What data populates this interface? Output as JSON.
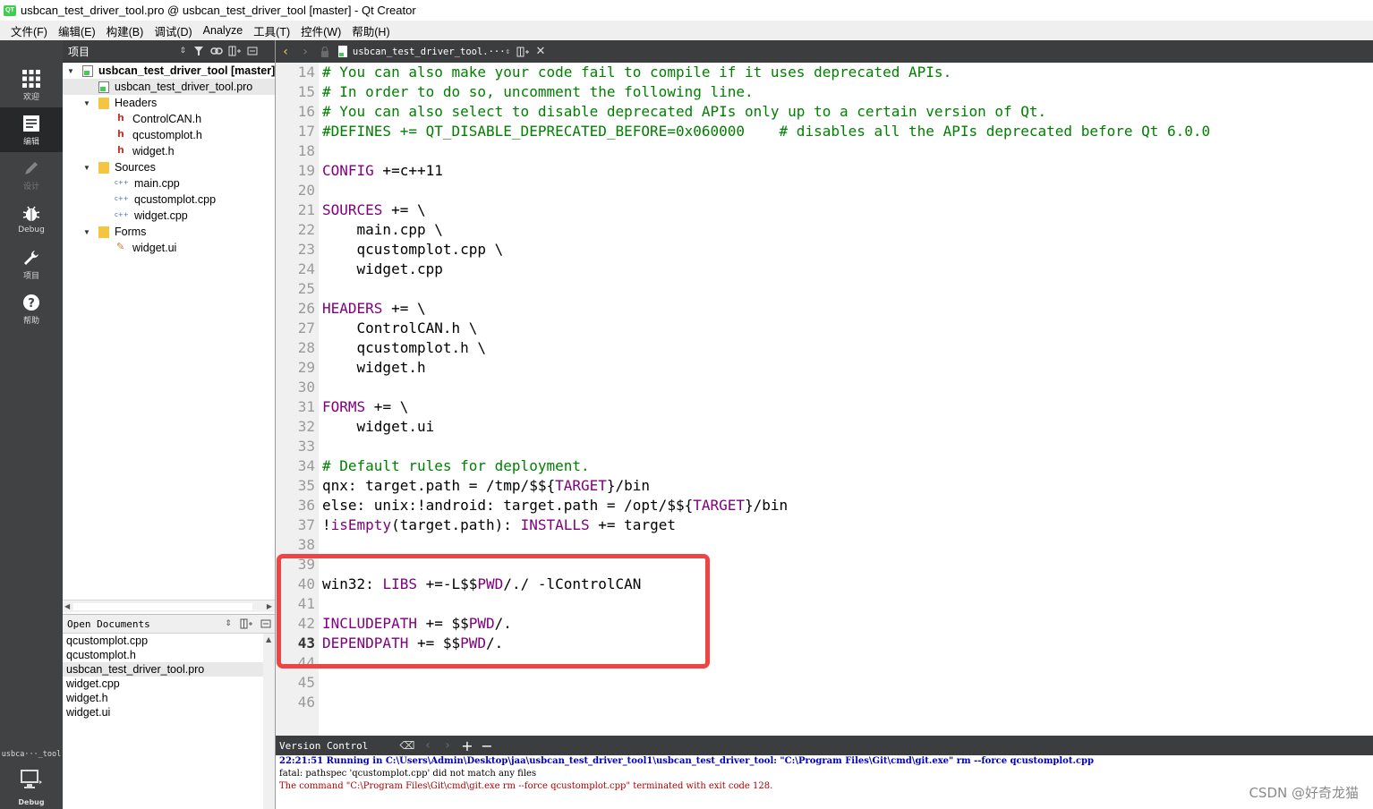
{
  "window": {
    "title": "usbcan_test_driver_tool.pro @ usbcan_test_driver_tool [master] - Qt Creator"
  },
  "menubar": [
    "文件(F)",
    "编辑(E)",
    "构建(B)",
    "调试(D)",
    "Analyze",
    "工具(T)",
    "控件(W)",
    "帮助(H)"
  ],
  "modes": [
    {
      "label": "欢迎",
      "icon": "grid-icon",
      "active": false
    },
    {
      "label": "编辑",
      "icon": "edit-document-icon",
      "active": true
    },
    {
      "label": "设计",
      "icon": "pencil-icon",
      "active": false
    },
    {
      "label": "Debug",
      "icon": "bug-icon",
      "active": false
    },
    {
      "label": "项目",
      "icon": "wrench-icon",
      "active": false
    },
    {
      "label": "帮助",
      "icon": "help-icon",
      "active": false
    }
  ],
  "kit": {
    "label": "usbca···_tool",
    "mode": "Debug",
    "icon": "monitor-icon"
  },
  "project_panel": {
    "combo_label": "项目",
    "tree": [
      {
        "label": "usbcan_test_driver_tool [master]",
        "type": "project",
        "level": 0,
        "expanded": true,
        "bold": true
      },
      {
        "label": "usbcan_test_driver_tool.pro",
        "type": "pro",
        "level": 1,
        "selected": true
      },
      {
        "label": "Headers",
        "type": "folder",
        "level": 1,
        "expanded": true
      },
      {
        "label": "ControlCAN.h",
        "type": "h",
        "level": 2
      },
      {
        "label": "qcustomplot.h",
        "type": "h",
        "level": 2
      },
      {
        "label": "widget.h",
        "type": "h",
        "level": 2
      },
      {
        "label": "Sources",
        "type": "folder",
        "level": 1,
        "expanded": true
      },
      {
        "label": "main.cpp",
        "type": "cpp",
        "level": 2
      },
      {
        "label": "qcustomplot.cpp",
        "type": "cpp",
        "level": 2
      },
      {
        "label": "widget.cpp",
        "type": "cpp",
        "level": 2
      },
      {
        "label": "Forms",
        "type": "forms",
        "level": 1,
        "expanded": true
      },
      {
        "label": "widget.ui",
        "type": "ui",
        "level": 2
      }
    ]
  },
  "open_documents": {
    "title": "Open Documents",
    "items": [
      {
        "label": "qcustomplot.cpp",
        "selected": false
      },
      {
        "label": "qcustomplot.h",
        "selected": false
      },
      {
        "label": "usbcan_test_driver_tool.pro",
        "selected": true
      },
      {
        "label": "widget.cpp",
        "selected": false
      },
      {
        "label": "widget.h",
        "selected": false
      },
      {
        "label": "widget.ui",
        "selected": false
      }
    ]
  },
  "editor": {
    "current_document": "usbcan_test_driver_tool.···",
    "current_line": 43,
    "lines": [
      {
        "n": 14,
        "parts": [
          {
            "t": "# You can also make your code fail to compile if it uses deprecated APIs.",
            "c": "cm"
          }
        ]
      },
      {
        "n": 15,
        "parts": [
          {
            "t": "# In order to do so, uncomment the following line.",
            "c": "cm"
          }
        ]
      },
      {
        "n": 16,
        "parts": [
          {
            "t": "# You can also select to disable deprecated APIs only up to a certain version of Qt.",
            "c": "cm"
          }
        ]
      },
      {
        "n": 17,
        "parts": [
          {
            "t": "#DEFINES += QT_DISABLE_DEPRECATED_BEFORE=0x060000    # disables all the APIs deprecated before Qt 6.0.0",
            "c": "cm"
          }
        ]
      },
      {
        "n": 18,
        "parts": []
      },
      {
        "n": 19,
        "parts": [
          {
            "t": "CONFIG",
            "c": "kw"
          },
          {
            "t": " +=c++11",
            "c": ""
          }
        ]
      },
      {
        "n": 20,
        "parts": []
      },
      {
        "n": 21,
        "parts": [
          {
            "t": "SOURCES",
            "c": "kw"
          },
          {
            "t": " += \\",
            "c": ""
          }
        ]
      },
      {
        "n": 22,
        "parts": [
          {
            "t": "    main.cpp \\",
            "c": ""
          }
        ]
      },
      {
        "n": 23,
        "parts": [
          {
            "t": "    qcustomplot.cpp \\",
            "c": ""
          }
        ]
      },
      {
        "n": 24,
        "parts": [
          {
            "t": "    widget.cpp",
            "c": ""
          }
        ]
      },
      {
        "n": 25,
        "parts": []
      },
      {
        "n": 26,
        "parts": [
          {
            "t": "HEADERS",
            "c": "kw"
          },
          {
            "t": " += \\",
            "c": ""
          }
        ]
      },
      {
        "n": 27,
        "parts": [
          {
            "t": "    ControlCAN.h \\",
            "c": ""
          }
        ]
      },
      {
        "n": 28,
        "parts": [
          {
            "t": "    qcustomplot.h \\",
            "c": ""
          }
        ]
      },
      {
        "n": 29,
        "parts": [
          {
            "t": "    widget.h",
            "c": ""
          }
        ]
      },
      {
        "n": 30,
        "parts": []
      },
      {
        "n": 31,
        "parts": [
          {
            "t": "FORMS",
            "c": "kw"
          },
          {
            "t": " += \\",
            "c": ""
          }
        ]
      },
      {
        "n": 32,
        "parts": [
          {
            "t": "    widget.ui",
            "c": ""
          }
        ]
      },
      {
        "n": 33,
        "parts": []
      },
      {
        "n": 34,
        "parts": [
          {
            "t": "# Default rules for deployment.",
            "c": "cm"
          }
        ]
      },
      {
        "n": 35,
        "parts": [
          {
            "t": "qnx: target.path = /tmp/$${",
            "c": ""
          },
          {
            "t": "TARGET",
            "c": "kw"
          },
          {
            "t": "}/bin",
            "c": ""
          }
        ]
      },
      {
        "n": 36,
        "parts": [
          {
            "t": "else: unix:!android: target.path = /opt/$${",
            "c": ""
          },
          {
            "t": "TARGET",
            "c": "kw"
          },
          {
            "t": "}/bin",
            "c": ""
          }
        ]
      },
      {
        "n": 37,
        "parts": [
          {
            "t": "!",
            "c": ""
          },
          {
            "t": "isEmpty",
            "c": "kw"
          },
          {
            "t": "(target.path): ",
            "c": ""
          },
          {
            "t": "INSTALLS",
            "c": "kw"
          },
          {
            "t": " += target",
            "c": ""
          }
        ]
      },
      {
        "n": 38,
        "parts": []
      },
      {
        "n": 39,
        "parts": []
      },
      {
        "n": 40,
        "parts": [
          {
            "t": "win32: ",
            "c": ""
          },
          {
            "t": "LIBS",
            "c": "kw"
          },
          {
            "t": " +=-L$$",
            "c": ""
          },
          {
            "t": "PWD",
            "c": "kw"
          },
          {
            "t": "/./ -lControlCAN",
            "c": ""
          }
        ]
      },
      {
        "n": 41,
        "parts": []
      },
      {
        "n": 42,
        "parts": [
          {
            "t": "INCLUDEPATH",
            "c": "kw"
          },
          {
            "t": " += $$",
            "c": ""
          },
          {
            "t": "PWD",
            "c": "kw"
          },
          {
            "t": "/.",
            "c": ""
          }
        ]
      },
      {
        "n": 43,
        "parts": [
          {
            "t": "DEPENDPATH",
            "c": "kw"
          },
          {
            "t": " += $$",
            "c": ""
          },
          {
            "t": "PWD",
            "c": "kw"
          },
          {
            "t": "/.",
            "c": ""
          }
        ]
      },
      {
        "n": 44,
        "parts": []
      },
      {
        "n": 45,
        "parts": []
      },
      {
        "n": 46,
        "parts": []
      }
    ]
  },
  "version_control": {
    "title": "Version Control",
    "log": [
      {
        "text": "22:21:51 Running in C:\\Users\\Admin\\Desktop\\jaa\\usbcan_test_driver_tool1\\usbcan_test_driver_tool: \"C:\\Program Files\\Git\\cmd\\git.exe\" rm --force qcustomplot.cpp",
        "style": "vc-blue"
      },
      {
        "text": "fatal: pathspec 'qcustomplot.cpp' did not match any files",
        "style": "vc-black"
      },
      {
        "text": "The command \"C:\\Program Files\\Git\\cmd\\git.exe rm --force qcustomplot.cpp\" terminated with exit code 128.",
        "style": "vc-red"
      }
    ]
  },
  "watermark": "CSDN @好奇龙猫",
  "colors": {
    "accent_box": "#ef4444",
    "keyword": "#800080",
    "comment": "#008000",
    "sidebar": "#404244"
  }
}
